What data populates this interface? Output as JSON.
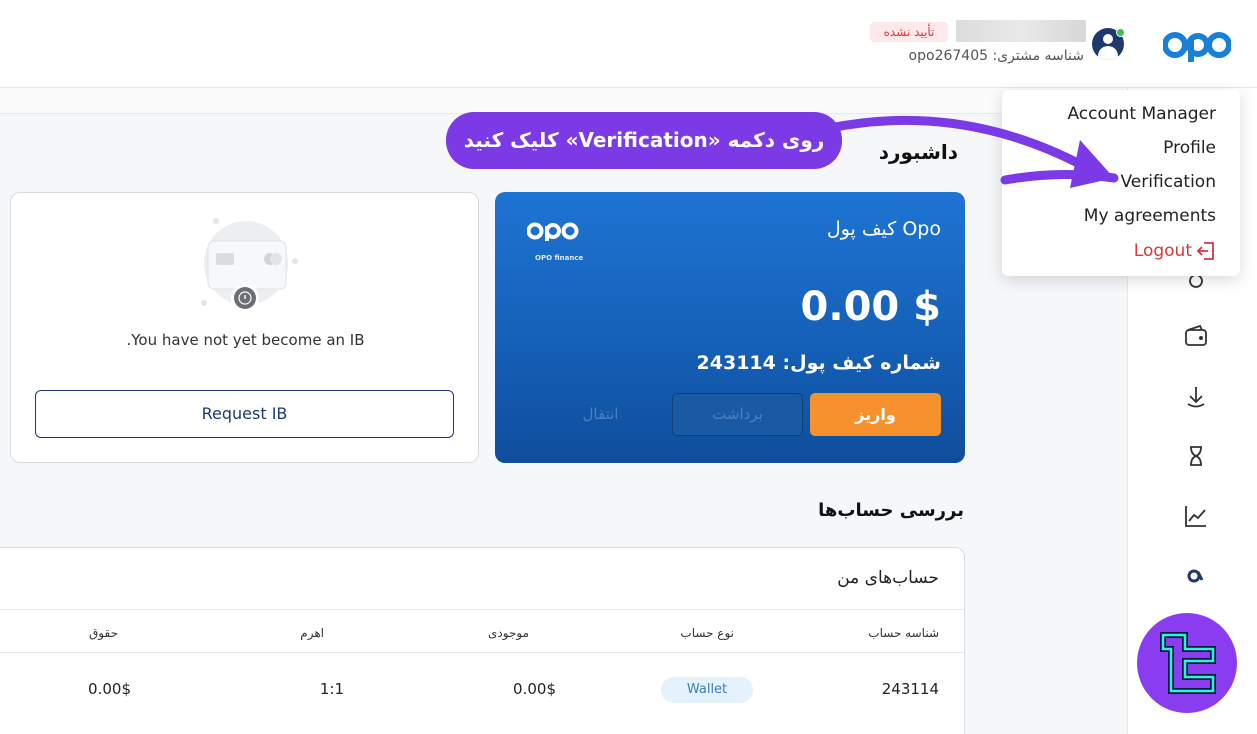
{
  "header": {
    "brand": "opo",
    "status_badge": "تأیید نشده",
    "client_id_label": "شناسه مشتری: opo267405"
  },
  "dashboard": {
    "title": "داشبورد"
  },
  "wallet": {
    "title": "کیف پول Opo",
    "brand": "opo",
    "brand_sub": "OPO finance",
    "amount": "0.00 $",
    "number_label": "شماره کیف پول: 243114",
    "deposit_label": "واریز",
    "withdraw_label": "برداشت",
    "transfer_label": "انتقال"
  },
  "ib": {
    "message": ".You have not yet become an IB",
    "button_label": "Request IB"
  },
  "accounts": {
    "section_title": "بررسی حساب‌ها",
    "card_title": "حساب‌های من",
    "columns": [
      "شناسه حساب",
      "نوع حساب",
      "موجودی",
      "اهرم",
      "حقوق"
    ],
    "rows": [
      {
        "id": "243114",
        "type": "Wallet",
        "balance": "0.00$",
        "leverage": "1:1",
        "equity": "0.00$"
      }
    ]
  },
  "dropdown": {
    "items": [
      "Account Manager",
      "Profile",
      "Verification",
      "My agreements"
    ],
    "logout_label": "Logout"
  },
  "callout": {
    "text": "روی دکمه «Verification» کلیک کنید"
  },
  "sidebar": {
    "icons": [
      "home-icon",
      "user-icon",
      "wallet-icon",
      "download-icon",
      "hourglass-icon",
      "chart-icon",
      "brand-icon"
    ]
  },
  "colors": {
    "accent": "#7b3ae6",
    "brand": "#1560b8",
    "deposit": "#f5922b",
    "logout": "#d9363e"
  }
}
